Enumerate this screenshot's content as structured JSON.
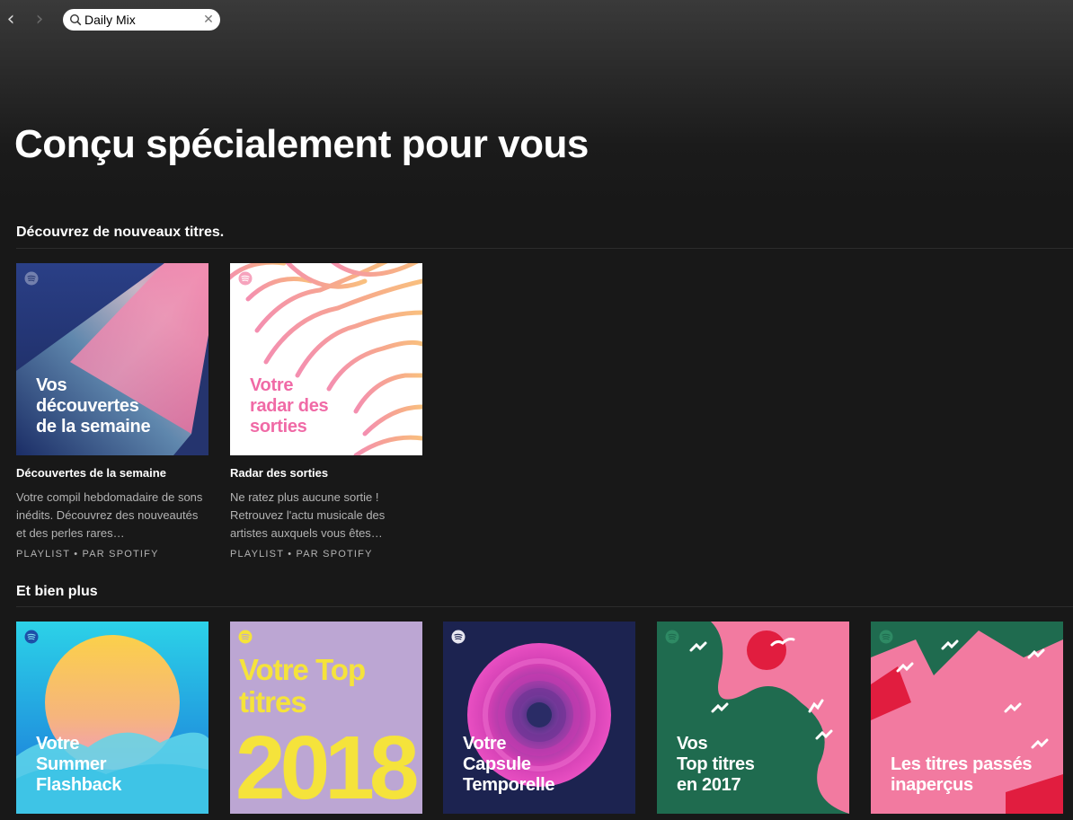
{
  "search": {
    "value": "Daily Mix"
  },
  "page_title": "Conçu spécialement pour vous",
  "sections": [
    {
      "title": "Découvrez de nouveaux titres.",
      "cards": [
        {
          "cover_text": [
            "Vos",
            "découvertes",
            "de la semaine"
          ],
          "title": "Découvertes de la semaine",
          "description": "Votre compil hebdomadaire de sons inédits. Découvrez des nouveautés et des perles rares…",
          "meta": "PLAYLIST • PAR SPOTIFY"
        },
        {
          "cover_text": [
            "Votre",
            "radar des",
            "sorties"
          ],
          "title": "Radar des sorties",
          "description": "Ne ratez plus aucune sortie ! Retrouvez l'actu musicale des artistes auxquels vous êtes…",
          "meta": "PLAYLIST • PAR SPOTIFY"
        }
      ]
    },
    {
      "title": "Et bien plus",
      "cards": [
        {
          "cover_text": [
            "Votre",
            "Summer",
            "Flashback"
          ]
        },
        {
          "cover_text": [
            "Votre Top",
            "titres",
            "2018"
          ]
        },
        {
          "cover_text": [
            "Votre",
            "Capsule",
            "Temporelle"
          ]
        },
        {
          "cover_text": [
            "Vos",
            "Top titres",
            "en 2017"
          ]
        },
        {
          "cover_text": [
            "Les titres passés",
            "inaperçus"
          ]
        }
      ]
    }
  ],
  "colors": {
    "background": "#181818",
    "radar_pink": "#f06aa6",
    "top2018_yellow": "#f5e33b",
    "top2018_bg": "#bca6d3",
    "top2017_green": "#1f6b4f",
    "pink": "#f27aa0"
  }
}
